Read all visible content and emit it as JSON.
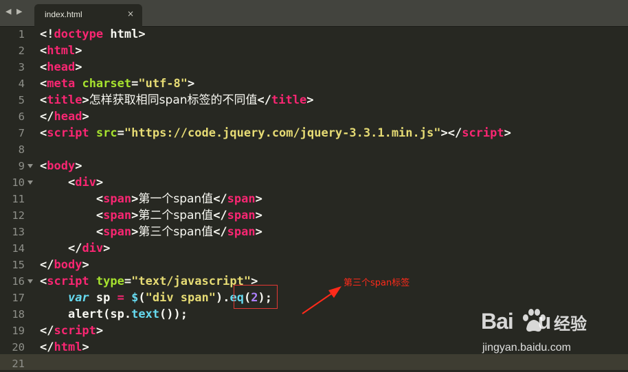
{
  "tab": {
    "title": "index.html",
    "close_glyph": "×",
    "nav_arrows": "◀ ▶"
  },
  "line_numbers": [
    "1",
    "2",
    "3",
    "4",
    "5",
    "6",
    "7",
    "8",
    "9",
    "10",
    "11",
    "12",
    "13",
    "14",
    "15",
    "16",
    "17",
    "18",
    "19",
    "20",
    "21"
  ],
  "fold_markers": [
    "9",
    "10",
    "16"
  ],
  "code": {
    "l1": {
      "open": "<!",
      "kw": "doctype",
      "rest": " html",
      "close": ">"
    },
    "l2": {
      "open": "<",
      "tag": "html",
      "close": ">"
    },
    "l3": {
      "open": "<",
      "tag": "head",
      "close": ">"
    },
    "l4": {
      "open": "<",
      "tag": "meta",
      "sp": " ",
      "attr": "charset",
      "eq": "=",
      "val": "\"utf-8\"",
      "close": ">"
    },
    "l5": {
      "open": "<",
      "tag": "title",
      "close": ">",
      "text": "怎样获取相同span标签的不同值",
      "open2": "</",
      "tag2": "title",
      "close2": ">"
    },
    "l6": {
      "open": "</",
      "tag": "head",
      "close": ">"
    },
    "l7": {
      "open": "<",
      "tag": "script",
      "sp": " ",
      "attr": "src",
      "eq": "=",
      "val": "\"https://code.jquery.com/jquery-3.3.1.min.js\"",
      "close": ">",
      "open2": "</",
      "tag2": "script",
      "close2": ">"
    },
    "l9": {
      "open": "<",
      "tag": "body",
      "close": ">"
    },
    "l10": {
      "indent": "    ",
      "open": "<",
      "tag": "div",
      "close": ">"
    },
    "l11": {
      "indent": "        ",
      "open": "<",
      "tag": "span",
      "close": ">",
      "text": "第一个span值",
      "open2": "</",
      "tag2": "span",
      "close2": ">"
    },
    "l12": {
      "indent": "        ",
      "open": "<",
      "tag": "span",
      "close": ">",
      "text": "第二个span值",
      "open2": "</",
      "tag2": "span",
      "close2": ">"
    },
    "l13": {
      "indent": "        ",
      "open": "<",
      "tag": "span",
      "close": ">",
      "text": "第三个span值",
      "open2": "</",
      "tag2": "span",
      "close2": ">"
    },
    "l14": {
      "indent": "    ",
      "open": "</",
      "tag": "div",
      "close": ">"
    },
    "l15": {
      "open": "</",
      "tag": "body",
      "close": ">"
    },
    "l16": {
      "open": "<",
      "tag": "script",
      "sp": " ",
      "attr": "type",
      "eq": "=",
      "val": "\"text/javascript\"",
      "close": ">"
    },
    "l17": {
      "indent": "    ",
      "kw": "var",
      "p1": " sp ",
      "op": "=",
      "p2": " ",
      "fn": "$",
      "p3": "(",
      "str": "\"div span\"",
      "p4": ")",
      "p5": ".",
      "method": "eq",
      "p6": "(",
      "num": "2",
      "p7": ");"
    },
    "l18": {
      "indent": "    ",
      "p1": "alert(sp.",
      "method": "text",
      "p2": "());"
    },
    "l19": {
      "open": "</",
      "tag": "script",
      "close": ">"
    },
    "l20": {
      "open": "</",
      "tag": "html",
      "close": ">"
    }
  },
  "annotation": {
    "text": "第三个span标签",
    "color": "#ff2a1a"
  },
  "watermark": {
    "logo": "Bai",
    "logo_tail": "u",
    "brand": "经验",
    "url": "jingyan.baidu.com"
  },
  "colors": {
    "background": "#272822",
    "tag": "#f92672",
    "attribute": "#a6e22e",
    "string": "#e6db74",
    "number": "#ae81ff",
    "keyword": "#66d9ef",
    "text": "#f8f8f2"
  }
}
